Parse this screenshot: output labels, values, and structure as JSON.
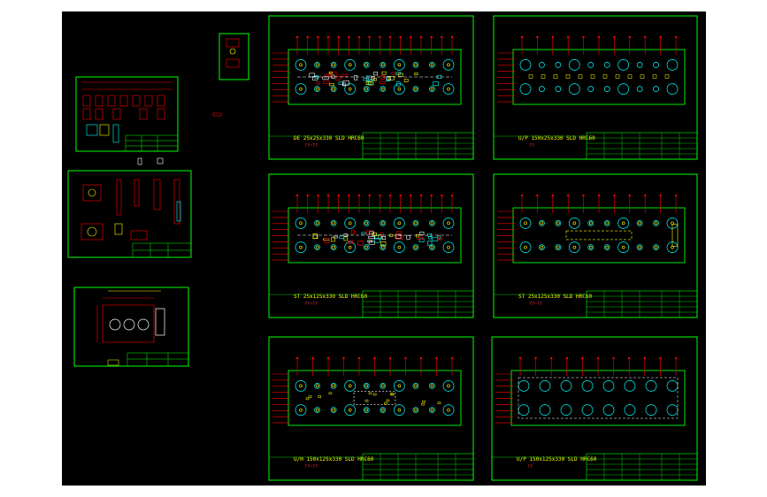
{
  "colors": {
    "background": "#000000",
    "border": "#00ff00",
    "dimension": "#ff0000",
    "text": "#ffff00",
    "hole_circle": "#00ffff",
    "magenta": "#ff00ff",
    "white": "#ffffff"
  },
  "sheets": [
    {
      "id": "detail-sheet-a"
    },
    {
      "id": "detail-sheet-b"
    },
    {
      "id": "detail-sheet-c"
    },
    {
      "id": "small-preview"
    },
    {
      "id": "plate-sheet-1",
      "caption": "DE 25x25x330 SLD HRC60",
      "subcaption": "??~??"
    },
    {
      "id": "plate-sheet-2",
      "caption": "U/P 150x25x330 SLD HRC60",
      "subcaption": "??"
    },
    {
      "id": "plate-sheet-3",
      "caption": "ST 25x125x330 SLD HRC60",
      "subcaption": "??~??"
    },
    {
      "id": "plate-sheet-4",
      "caption": "ST 25x125x330 SLD HRC60",
      "subcaption": "??~??"
    },
    {
      "id": "plate-sheet-5",
      "caption": "U/H 150x125x330 SLD HRC60",
      "subcaption": "??~??"
    },
    {
      "id": "plate-sheet-6",
      "caption": "U/P 150x125x330 SLD HRC60",
      "subcaption": "??"
    }
  ]
}
